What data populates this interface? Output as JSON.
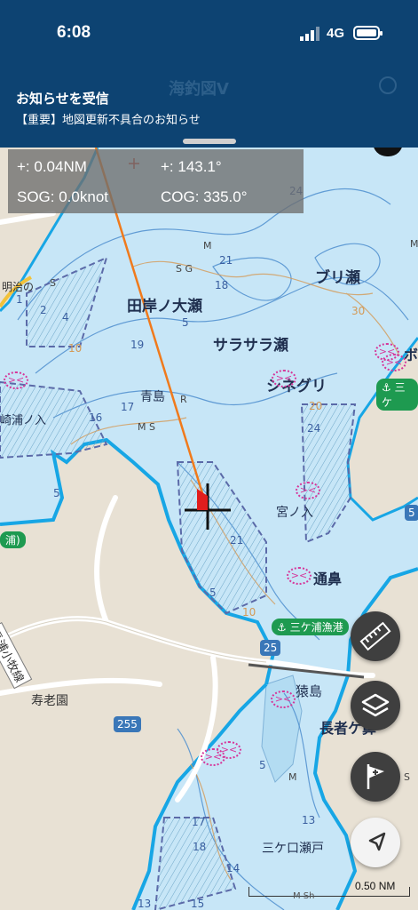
{
  "status_bar": {
    "time": "6:08",
    "network": "4G"
  },
  "app": {
    "title": "海釣図V"
  },
  "notification": {
    "title": "お知らせを受信",
    "body": "【重要】地図更新不具合のお知らせ"
  },
  "readout": {
    "distance": "+: 0.04NM",
    "bearing": "+: 143.1°",
    "sog": "SOG: 0.0knot",
    "cog": "COG: 335.0°"
  },
  "map_labels": {
    "bold_places": [
      "田岸ノ大瀬",
      "ブリ瀬",
      "サラサラ瀬",
      "シネグリ",
      "通鼻",
      "長者ケ鼻",
      "ボ"
    ],
    "places": [
      "青島",
      "宮ノ入",
      "猿島",
      "寿老園",
      "三ケ口瀬戸",
      "崎浦ノ入",
      "明治の"
    ],
    "roads": [
      "長浦小牧線",
      "浦)"
    ],
    "harbor_tags": [
      "三ケ浦漁港",
      "三ケ"
    ],
    "route_no": [
      "255",
      "25",
      "5"
    ],
    "depths": [
      "1",
      "2",
      "4",
      "5",
      "10",
      "19",
      "16",
      "17",
      "18",
      "21",
      "20",
      "24",
      "30",
      "5",
      "21",
      "10",
      "5",
      "5",
      "13",
      "17",
      "18",
      "14",
      "13",
      "15",
      "20",
      "24"
    ],
    "bottom_marks": [
      "M",
      "S G",
      "M",
      "R",
      "M S",
      "S",
      "M",
      "M",
      "S"
    ],
    "scale": "0.50 NM",
    "scale_note": "M Sh"
  },
  "colors": {
    "status_bg": "#0d4372",
    "water": "#c7e6f7",
    "land": "#e8e1d4",
    "harbor": "#1e9a50",
    "fish": "#d6369a",
    "contour": "#d49a56",
    "route": "#f07a1c",
    "marker": "#e11d1d"
  }
}
